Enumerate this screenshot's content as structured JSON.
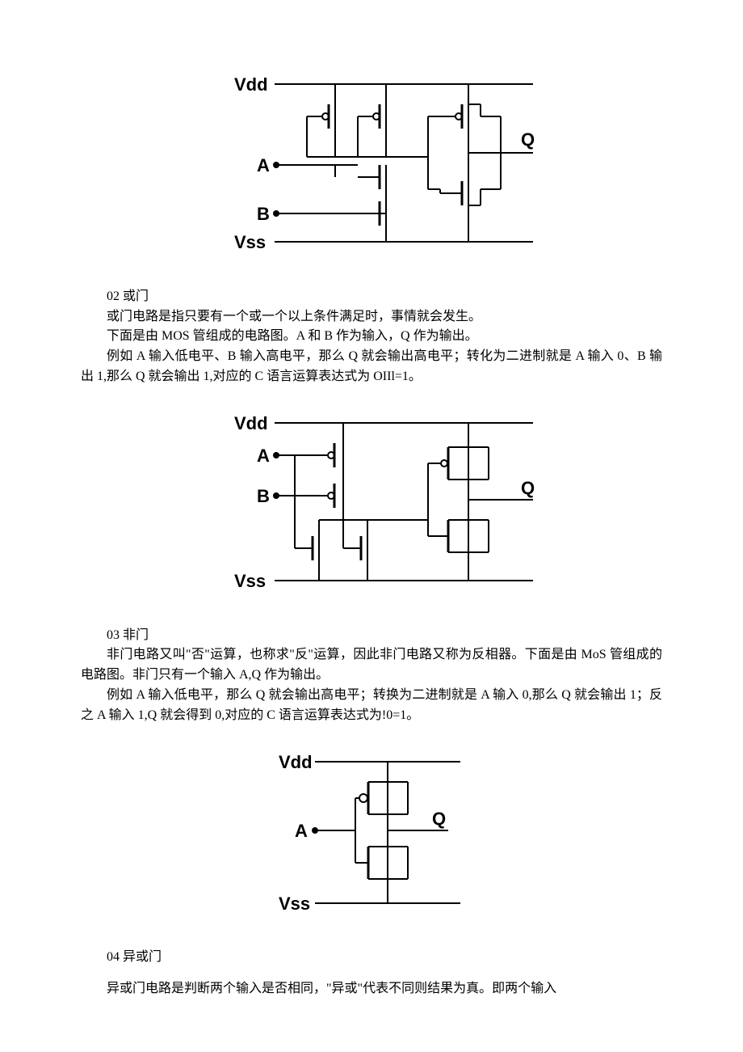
{
  "figure1": {
    "labels": {
      "vdd": "Vdd",
      "a": "A",
      "b": "B",
      "vss": "Vss",
      "q": "Q"
    }
  },
  "section_or": {
    "heading": "02 或门",
    "p1": "或门电路是指只要有一个或一个以上条件满足时，事情就会发生。",
    "p2": "下面是由 MOS 管组成的电路图。A 和 B 作为输入，Q 作为输出。",
    "p3": "例如 A 输入低电平、B 输入高电平，那么 Q 就会输出高电平；转化为二进制就是 A 输入 0、B 输出 1,那么 Q 就会输出 1,对应的 C 语言运算表达式为 OIIl=1。"
  },
  "figure2": {
    "labels": {
      "vdd": "Vdd",
      "a": "A",
      "b": "B",
      "vss": "Vss",
      "q": "Q"
    }
  },
  "section_not": {
    "heading": "03 非门",
    "p1": "非门电路又叫\"否\"运算，也称求\"反\"运算，因此非门电路又称为反相器。下面是由 MoS 管组成的电路图。非门只有一个输入 A,Q 作为输出。",
    "p2": "例如 A 输入低电平，那么 Q 就会输出高电平；转换为二进制就是 A 输入 0,那么 Q 就会输出 1；反之 A 输入 1,Q 就会得到 0,对应的 C 语言运算表达式为!0=1。"
  },
  "figure3": {
    "labels": {
      "vdd": "Vdd",
      "a": "A",
      "vss": "Vss",
      "q": "Q"
    }
  },
  "section_xor": {
    "heading": "04 异或门",
    "p1": "异或门电路是判断两个输入是否相同，\"异或\"代表不同则结果为真。即两个输入"
  }
}
